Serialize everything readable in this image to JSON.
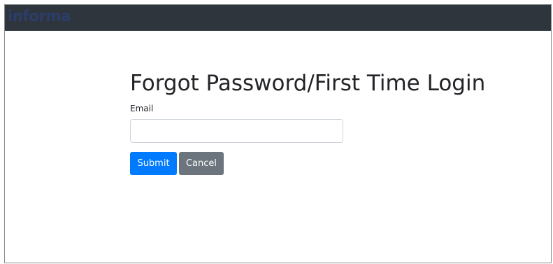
{
  "header": {
    "logo_text": "informa"
  },
  "form": {
    "title": "Forgot Password/First Time Login",
    "email_label": "Email",
    "email_value": "",
    "email_placeholder": "",
    "submit_label": "Submit",
    "cancel_label": "Cancel"
  },
  "colors": {
    "header_background": "#2f353d",
    "logo": "#2b3d6a",
    "submit_button": "#007bff",
    "cancel_button": "#6c757d"
  }
}
